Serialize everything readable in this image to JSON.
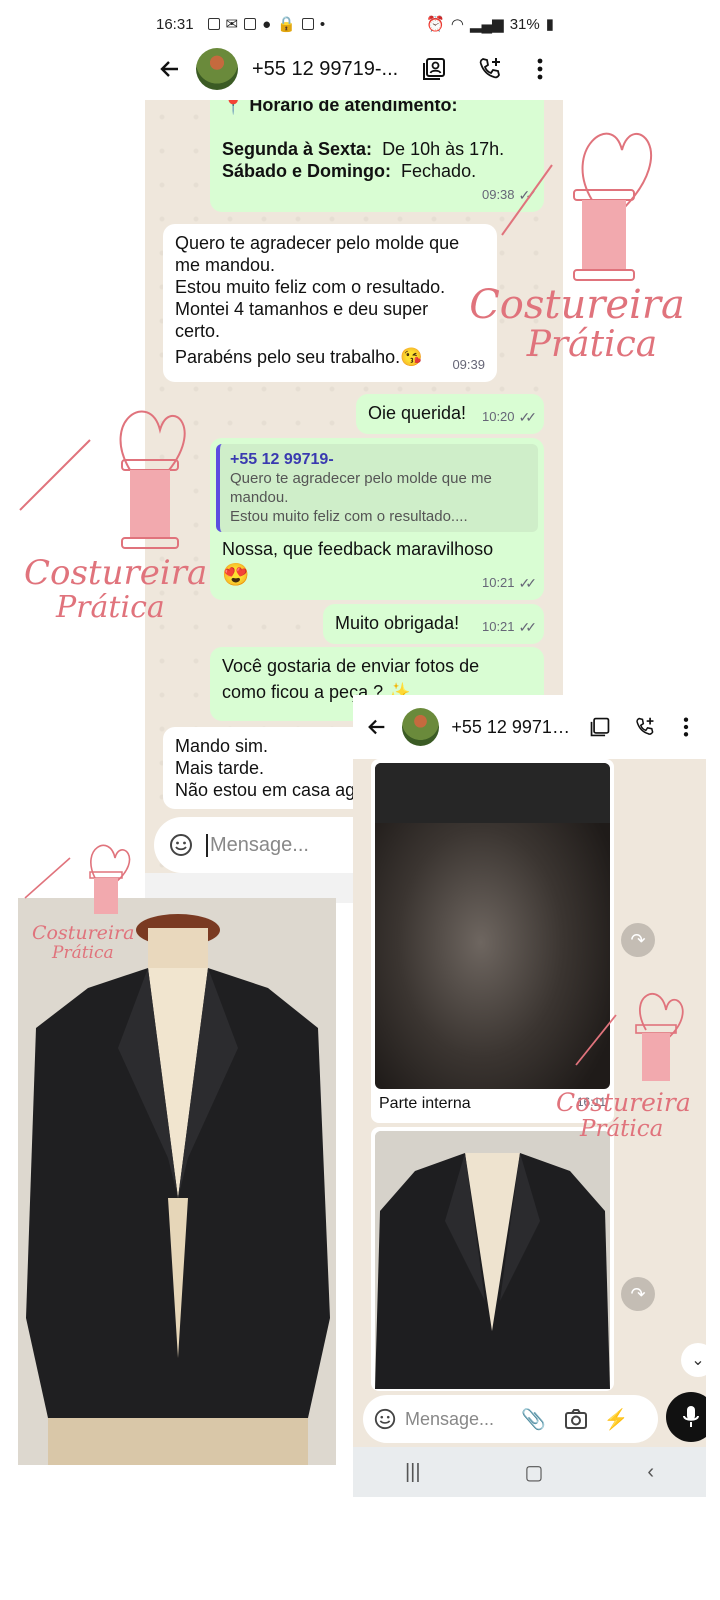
{
  "status": {
    "time": "16:31",
    "battery": "31%"
  },
  "header": {
    "contact": "+55 12 99719-..."
  },
  "messages": {
    "m1_title": "Horário de atendimento:",
    "m1_week_label": "Segunda à Sexta:",
    "m1_week_value": "De 10h às 17h.",
    "m1_weekend_label": "Sábado e Domingo:",
    "m1_weekend_value": "Fechado.",
    "m1_time": "09:38",
    "m2_l1": "Quero te agradecer pelo molde que",
    "m2_l2": "me mandou.",
    "m2_l3": "Estou muito feliz com o resultado.",
    "m2_l4": "Montei 4 tamanhos e deu super",
    "m2_l5": "certo.",
    "m2_l6": "Parabéns pelo seu trabalho.😘",
    "m2_time": "09:39",
    "m3_text": "Oie querida!",
    "m3_time": "10:20",
    "m4_quote_name": "+55 12 99719-",
    "m4_quote_l1": "Quero te agradecer pelo molde que me",
    "m4_quote_l2": "mandou.",
    "m4_quote_l3": "Estou muito feliz com o resultado....",
    "m4_text": "Nossa, que feedback maravilhoso",
    "m4_emoji": "😍",
    "m4_time": "10:21",
    "m5_text": "Muito obrigada!",
    "m5_time": "10:21",
    "m6_l1": "Você gostaria de enviar fotos de",
    "m6_l2": "como ficou a peça ? ✨",
    "m7_l1": "Mando sim.",
    "m7_l2": "Mais tarde.",
    "m7_l3": "Não estou em casa ag"
  },
  "input": {
    "placeholder": "Mensage..."
  },
  "phone2": {
    "contact": "+55 12 99719-...",
    "caption": "Parte interna",
    "caption_time": "16:11",
    "input_placeholder": "Mensage..."
  },
  "watermark": {
    "line1": "Costureira",
    "line2": "Prática",
    "color": "#e0737c"
  },
  "colors": {
    "outgoing_bubble": "#d9fdd3",
    "incoming_bubble": "#ffffff",
    "chat_background": "#efe7dc"
  }
}
